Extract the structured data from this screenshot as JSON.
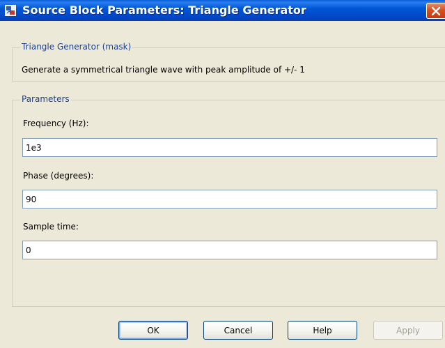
{
  "window": {
    "title": "Source Block Parameters: Triangle Generator",
    "icon": "simulink-block-icon"
  },
  "mask_group": {
    "legend": "Triangle Generator (mask)",
    "description": "Generate a symmetrical triangle wave with peak amplitude of +/- 1"
  },
  "params_group": {
    "legend": "Parameters",
    "fields": [
      {
        "label": "Frequency (Hz):",
        "value": "1e3"
      },
      {
        "label": "Phase (degrees):",
        "value": "90"
      },
      {
        "label": "Sample time:",
        "value": "0"
      }
    ]
  },
  "buttons": {
    "ok": "OK",
    "cancel": "Cancel",
    "help": "Help",
    "apply": "Apply"
  }
}
